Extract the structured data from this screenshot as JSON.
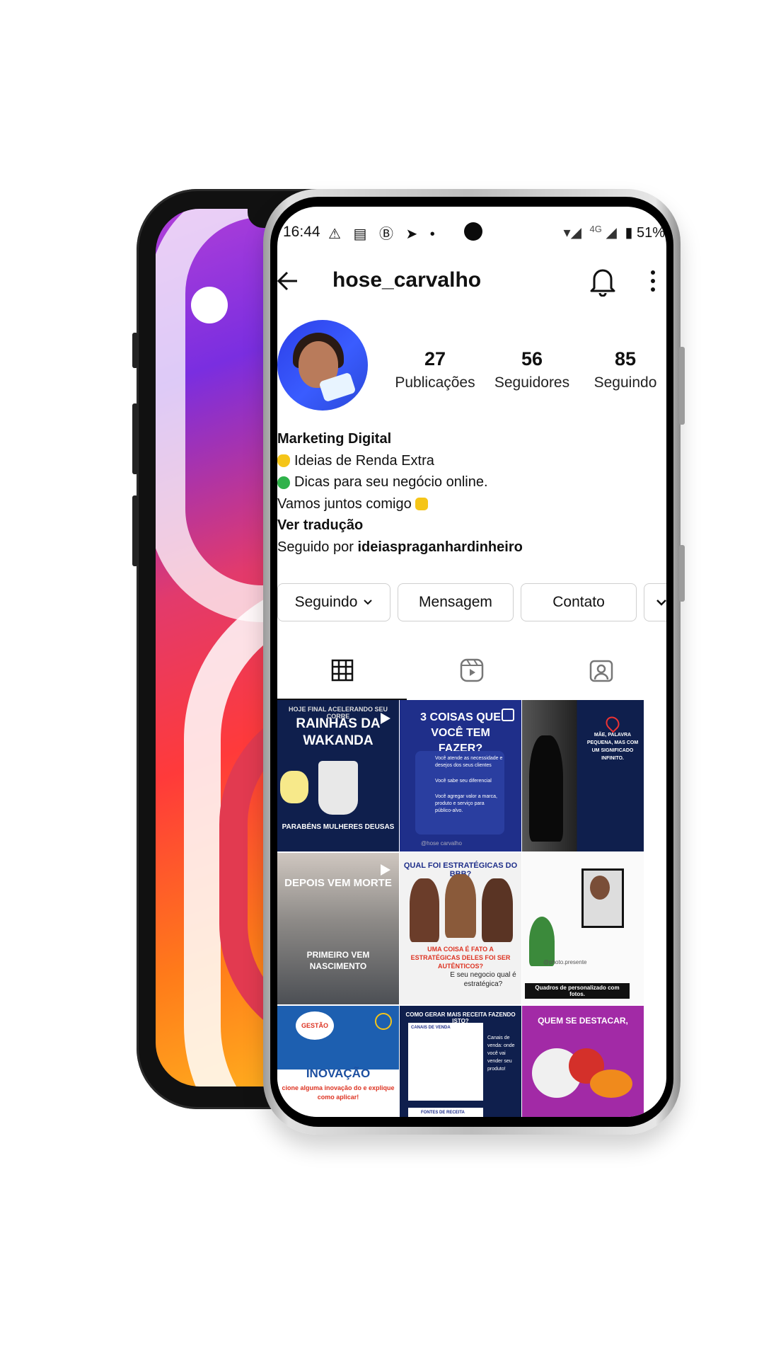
{
  "status_bar": {
    "time": "16:44",
    "network": "4G",
    "battery": "51%"
  },
  "header": {
    "username": "hose_carvalho"
  },
  "profile": {
    "stats": [
      {
        "value": "27",
        "label": "Publicações"
      },
      {
        "value": "56",
        "label": "Seguidores"
      },
      {
        "value": "85",
        "label": "Seguindo"
      }
    ],
    "bio": {
      "category": "Marketing Digital",
      "line1": "Ideias de Renda Extra",
      "line2": "Dicas para seu negócio online.",
      "line3": "Vamos juntos comigo",
      "translate": "Ver tradução",
      "followed_by_prefix": "Seguido por",
      "followed_by_user": "ideiaspraganhardinheiro"
    }
  },
  "actions": {
    "following": "Seguindo",
    "message": "Mensagem",
    "contact": "Contato"
  },
  "tabs": [
    "grid-icon",
    "reels-icon",
    "tagged-icon"
  ],
  "posts": [
    {
      "title": "RAINHAS DA WAKANDA",
      "top": "HOJE FINAL ACELERANDO SEU CORRE",
      "caption": "PARABÉNS MULHERES DEUSAS"
    },
    {
      "title": "3 COISAS QUE VOCÊ TEM FAZER?",
      "items": [
        "Você atende as necessidade e desejos dos seus clientes",
        "Você sabe seu diferencial",
        "Você agregar valor a marca, produto e serviço para público-alvo."
      ],
      "handle": "@hose carvalho"
    },
    {
      "title": "MÃE, PALAVRA PEQUENA, MAS COM UM SIGNIFICADO INFINITO."
    },
    {
      "title": "DEPOIS VEM MORTE",
      "caption": "PRIMEIRO VEM NASCIMENTO"
    },
    {
      "title": "QUAL FOI ESTRATÉGICAS DO BBB?",
      "caption": "UMA COISA É FATO A ESTRATÉGICAS DELES FOI SER AUTÊNTICOS?",
      "sub": "E seu negocio qual é estratégica?"
    },
    {
      "title": "@photo.presente",
      "caption": "Quadros de personalizado com fotos."
    },
    {
      "title": "INOVAÇÃO",
      "badge": "GESTÃO",
      "caption": "cione alguma inovação do e explique como aplicar!"
    },
    {
      "title": "COMO GERAR MAIS RECEITA FAZENDO ISTO?",
      "col1": "CANAIS DE VENDA",
      "col2": "FONTES DE RECEITA",
      "side": "Canais de venda: onde você vai vender seu produto!"
    },
    {
      "title": "QUEM SE DESTACAR,"
    }
  ],
  "colors": {
    "accent": "#111111",
    "post_navy": "#0f1f4d",
    "post_purple": "#a22aa6"
  }
}
